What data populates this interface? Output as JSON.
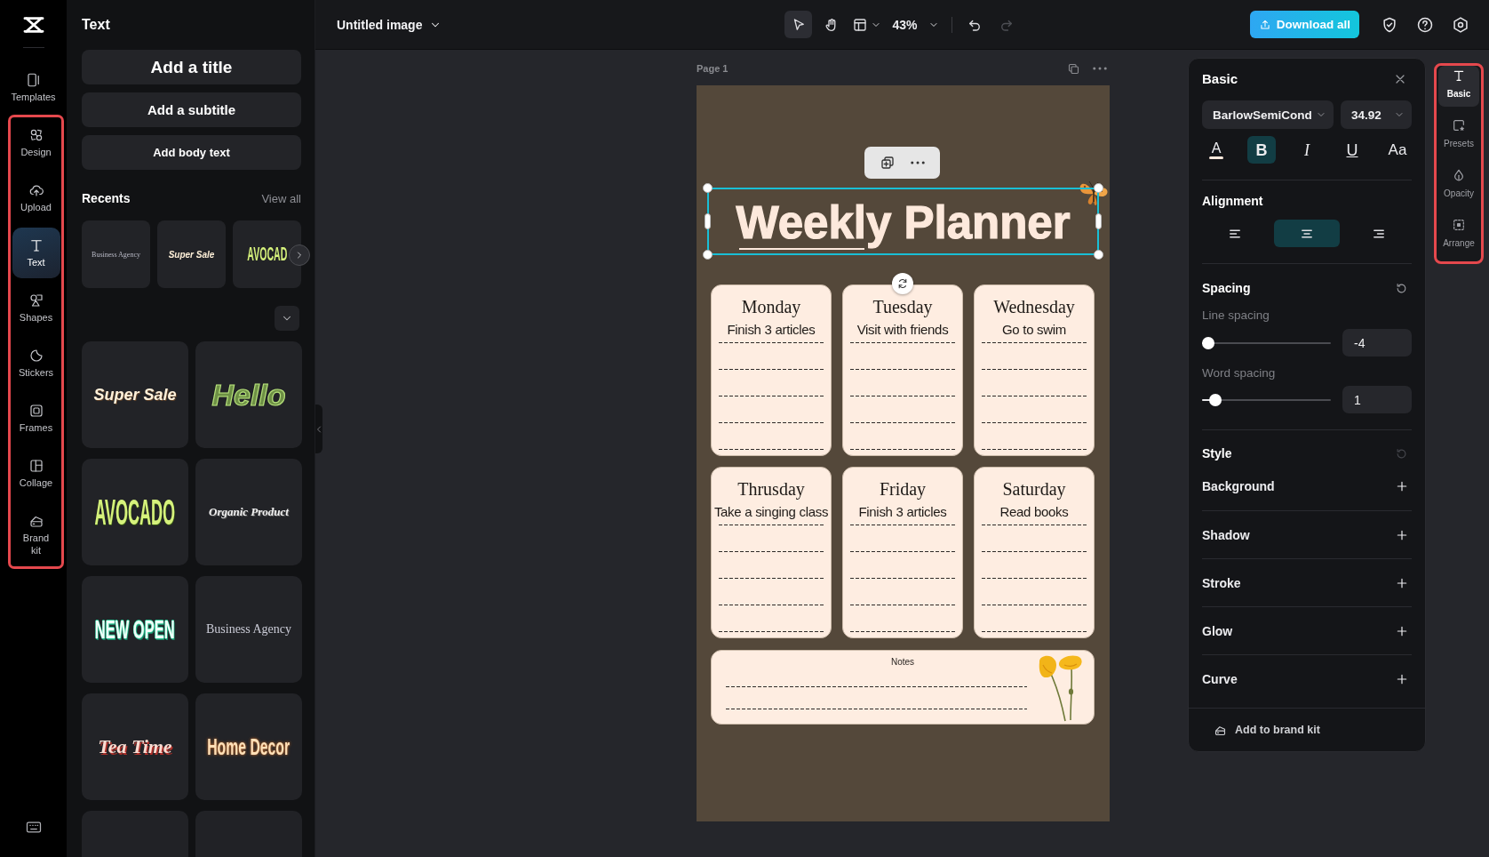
{
  "nav_rail": {
    "groups": [
      {
        "outlined": false,
        "items": [
          {
            "kind": "templates",
            "label": "Templates",
            "selected": false
          }
        ]
      },
      {
        "outlined": true,
        "items": [
          {
            "kind": "design",
            "label": "Design",
            "selected": false
          },
          {
            "kind": "upload",
            "label": "Upload",
            "selected": false
          },
          {
            "kind": "text",
            "label": "Text",
            "selected": true
          },
          {
            "kind": "shapes",
            "label": "Shapes",
            "selected": false
          },
          {
            "kind": "stickers",
            "label": "Stickers",
            "selected": false
          },
          {
            "kind": "frames",
            "label": "Frames",
            "selected": false
          },
          {
            "kind": "collage",
            "label": "Collage",
            "selected": false
          },
          {
            "kind": "brand",
            "label": "Brand kit",
            "selected": false
          }
        ]
      }
    ]
  },
  "text_panel": {
    "title": "Text",
    "add_buttons": [
      {
        "kind": "title",
        "label": "Add a title"
      },
      {
        "kind": "subtitle",
        "label": "Add a subtitle"
      },
      {
        "kind": "body",
        "label": "Add body text"
      }
    ],
    "recents": {
      "title": "Recents",
      "link": "View all",
      "items": [
        {
          "kind": "serif-small",
          "label": "Business Agency"
        },
        {
          "kind": "italic-small",
          "label": "Super Sale"
        },
        {
          "kind": "condensed-small",
          "label": "AVOCAD"
        }
      ]
    },
    "styles": [
      {
        "kind": "italic",
        "label": "Super Sale"
      },
      {
        "kind": "outline",
        "label": "Hello"
      },
      {
        "kind": "condensed",
        "label": "AVOCADO"
      },
      {
        "kind": "script",
        "label": "Organic Product"
      },
      {
        "kind": "block",
        "label": "NEW OPEN"
      },
      {
        "kind": "serif",
        "label": "Business Agency"
      },
      {
        "kind": "shadow",
        "label": "Tea Time"
      },
      {
        "kind": "glow",
        "label": "Home Decor"
      },
      {
        "kind": "blank"
      },
      {
        "kind": "blank"
      }
    ]
  },
  "top_bar": {
    "document_title": "Untitled image",
    "tools": {
      "select": {
        "selected": true
      },
      "hand": {
        "selected": false
      }
    },
    "zoom": "43%",
    "undo": {
      "disabled": false
    },
    "redo": {
      "disabled": true
    },
    "download_button": "Download all"
  },
  "canvas": {
    "page_label": "Page 1",
    "page": {
      "title": "Weekly Planner",
      "title_selected": true,
      "days": [
        {
          "name": "Monday",
          "task": "Finish 3 articles"
        },
        {
          "name": "Tuesday",
          "task": "Visit with friends"
        },
        {
          "name": "Wednesday",
          "task": "Go to swim"
        },
        {
          "name": "Thrusday",
          "task": "Take a singing class"
        },
        {
          "name": "Friday",
          "task": "Finish 3 articles"
        },
        {
          "name": "Saturday",
          "task": "Read books"
        }
      ],
      "notes_label": "Notes"
    }
  },
  "properties": {
    "title": "Basic",
    "font": "BarlowSemiCond",
    "font_size": "34.92",
    "format_buttons": [
      {
        "kind": "color",
        "glyph": "A",
        "color": "#fde9dc",
        "selected": false
      },
      {
        "kind": "bold",
        "glyph": "B",
        "selected": true
      },
      {
        "kind": "italic",
        "glyph": "I",
        "selected": false
      },
      {
        "kind": "underline",
        "glyph": "U",
        "selected": false
      },
      {
        "kind": "case",
        "glyph": "Aa",
        "selected": false
      }
    ],
    "alignment": {
      "title": "Alignment",
      "options": [
        {
          "kind": "left",
          "selected": false
        },
        {
          "kind": "center",
          "selected": true
        },
        {
          "kind": "right",
          "selected": false
        }
      ]
    },
    "spacing": {
      "title": "Spacing",
      "reset_disabled": false,
      "sliders": [
        {
          "label": "Line spacing",
          "level": 0.05,
          "value": "-4"
        },
        {
          "label": "Word spacing",
          "level": 0.1,
          "value": "1"
        }
      ]
    },
    "style": {
      "title": "Style",
      "reset_disabled": true,
      "options": [
        {
          "label": "Background"
        },
        {
          "label": "Shadow"
        },
        {
          "label": "Stroke"
        },
        {
          "label": "Glow"
        },
        {
          "label": "Curve"
        }
      ]
    },
    "footer_button": "Add to brand kit"
  },
  "side_tabs": {
    "outlined": true,
    "items": [
      {
        "kind": "basic",
        "label": "Basic",
        "selected": true
      },
      {
        "kind": "presets",
        "label": "Presets",
        "selected": false
      },
      {
        "kind": "opacity",
        "label": "Opacity",
        "selected": false
      },
      {
        "kind": "arrange",
        "label": "Arrange",
        "selected": false
      }
    ]
  }
}
